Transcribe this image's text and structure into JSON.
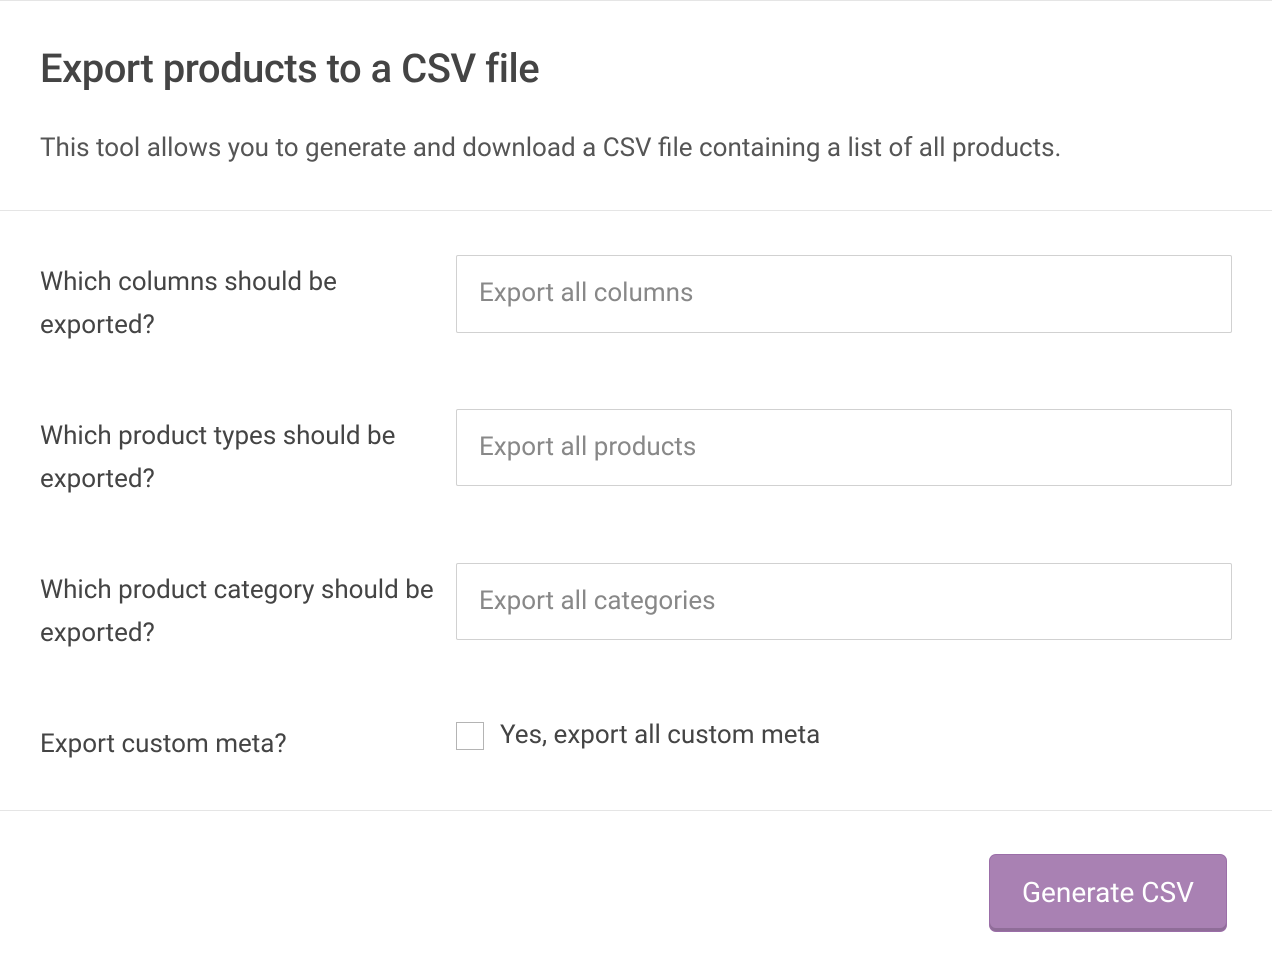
{
  "header": {
    "title": "Export products to a CSV file",
    "description": "This tool allows you to generate and download a CSV file containing a list of all products."
  },
  "form": {
    "columns": {
      "label": "Which columns should be exported?",
      "placeholder": "Export all columns"
    },
    "product_types": {
      "label": "Which product types should be exported?",
      "placeholder": "Export all products"
    },
    "category": {
      "label": "Which product category should be exported?",
      "placeholder": "Export all categories"
    },
    "custom_meta": {
      "label": "Export custom meta?",
      "checkbox_label": "Yes, export all custom meta"
    }
  },
  "footer": {
    "generate_label": "Generate CSV"
  }
}
